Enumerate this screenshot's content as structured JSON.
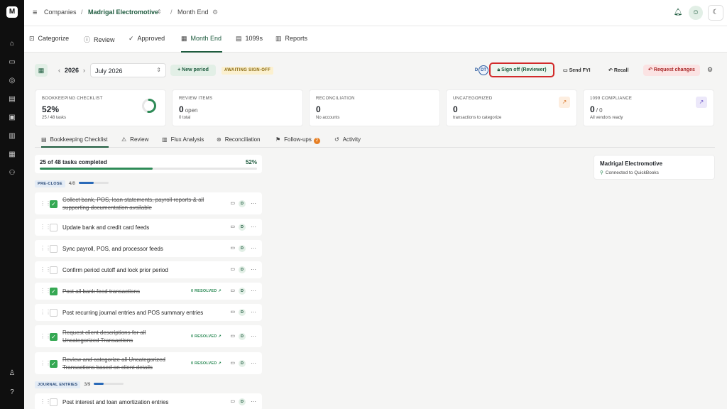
{
  "app": {
    "logo_text": "M"
  },
  "rail": {
    "icons": [
      "home-icon",
      "receipt-icon",
      "compass-icon",
      "book-icon",
      "briefcase-icon",
      "ledger-icon",
      "document-icon",
      "users-icon",
      "user-icon",
      "help-icon"
    ]
  },
  "topbar": {
    "menu_icon": "≡",
    "breadcrumb": {
      "root": "Companies",
      "company": "Madrigal Electromotive",
      "page": "Month End"
    }
  },
  "nav_tabs": [
    {
      "label": "Categorize",
      "icon": "⊡"
    },
    {
      "label": "Review",
      "icon": "ⓘ"
    },
    {
      "label": "Approved",
      "icon": "✓"
    },
    {
      "label": "Month End",
      "icon": "▦"
    },
    {
      "label": "1099s",
      "icon": "▤"
    },
    {
      "label": "Reports",
      "icon": "▥"
    }
  ],
  "toolbar": {
    "year": "2026",
    "month": "July 2026",
    "new_period": "+ New period",
    "status": "AWAITING SIGN-OFF",
    "reviewer_initials": [
      "D",
      "DT"
    ],
    "sign_off": "Sign off (Reviewer)",
    "send_fyi": "Send FYI",
    "recall": "Recall",
    "request_changes": "Request changes"
  },
  "cards": [
    {
      "label": "BOOKKEEPING CHECKLIST",
      "value": "52%",
      "unit": "",
      "sub": "25 / 48 tasks",
      "progress": 0.52
    },
    {
      "label": "REVIEW ITEMS",
      "value": "0",
      "unit": "open",
      "sub": "0 total"
    },
    {
      "label": "RECONCILIATION",
      "value": "0",
      "unit": "",
      "sub": "No accounts"
    },
    {
      "label": "UNCATEGORIZED",
      "value": "0",
      "unit": "",
      "sub": "transactions to categorize"
    },
    {
      "label": "1099 COMPLIANCE",
      "value": "0",
      "unit": "/ 0",
      "sub": "All vendors ready"
    }
  ],
  "sub_tabs": [
    {
      "label": "Bookkeeping Checklist",
      "icon": "▤"
    },
    {
      "label": "Review",
      "icon": "⚠"
    },
    {
      "label": "Flux Analysis",
      "icon": "▥"
    },
    {
      "label": "Reconciliation",
      "icon": "⊛"
    },
    {
      "label": "Follow-ups",
      "icon": "⚑",
      "badge": "2"
    },
    {
      "label": "Activity",
      "icon": "↺"
    }
  ],
  "progress": {
    "label": "25 of 48 tasks completed",
    "percent_text": "52%",
    "fraction": 0.52
  },
  "sections": [
    {
      "label": "PRE-CLOSE",
      "count": "4/8",
      "fraction": 0.5
    },
    {
      "label": "JOURNAL ENTRIES",
      "count": "3/9",
      "fraction": 0.33
    }
  ],
  "tasks": [
    {
      "title": "Collect bank, POS, loan statements, payroll reports & all supporting documentation available",
      "done": true,
      "resolved": ""
    },
    {
      "title": "Update bank and credit card feeds",
      "done": false,
      "resolved": ""
    },
    {
      "title": "Sync payroll, POS, and processor feeds",
      "done": false,
      "resolved": ""
    },
    {
      "title": "Confirm period cutoff and lock prior period",
      "done": false,
      "resolved": ""
    },
    {
      "title": "Post all bank feed transactions",
      "done": true,
      "resolved": "0 RESOLVED ↗"
    },
    {
      "title": "Post recurring journal entries and POS summary entries",
      "done": false,
      "resolved": ""
    },
    {
      "title": "Request client descriptions for all Uncategorized Transactions",
      "done": true,
      "resolved": "0 RESOLVED ↗"
    },
    {
      "title": "Review and categorize all Uncategorized Transactions based on client details",
      "done": true,
      "resolved": "0 RESOLVED ↗"
    },
    {
      "title": "Post interest and loan amortization entries",
      "done": false,
      "resolved": ""
    }
  ],
  "task_assignee": "D",
  "client": {
    "name": "Madrigal Electromotive",
    "status": "Connected to QuickBooks"
  },
  "colors": {
    "brand_green": "#1e5b3e",
    "check_green": "#35a853",
    "alert_red": "#d22b2b"
  }
}
